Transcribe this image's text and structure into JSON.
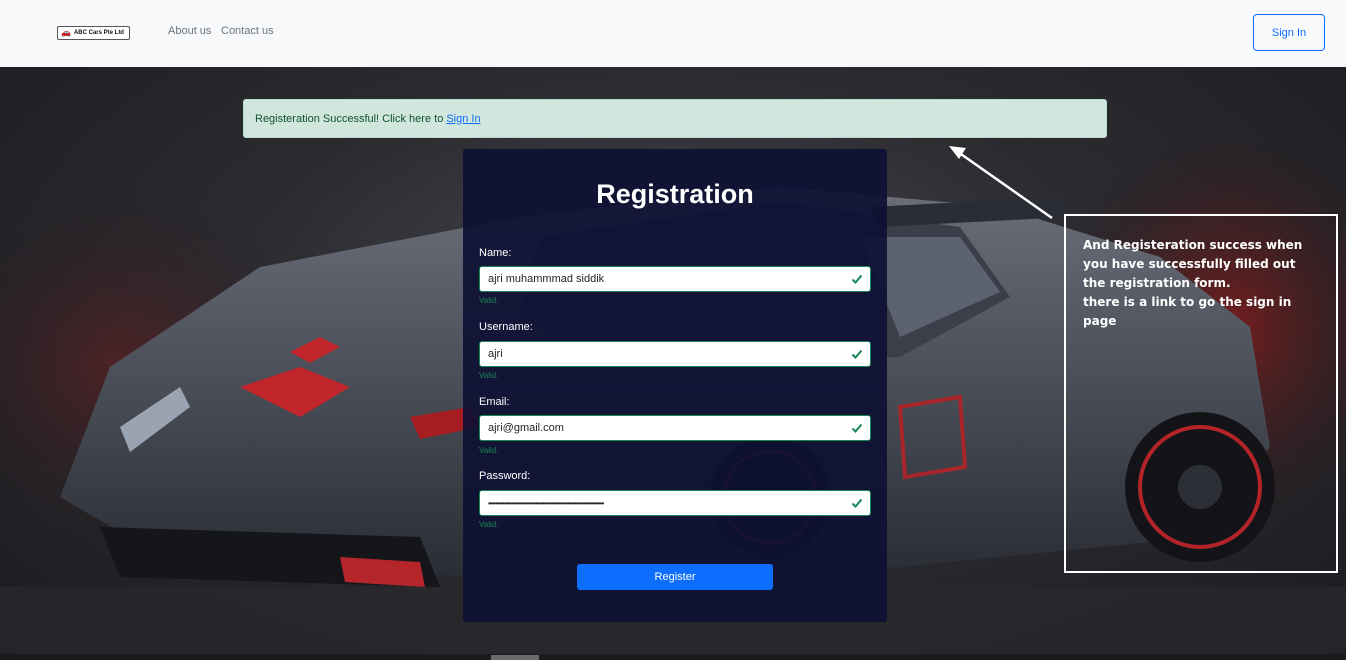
{
  "navbar": {
    "brand": "ABC Cars Pte Ltd",
    "brand_icon": "car-icon",
    "links": [
      "About us",
      "Contact us"
    ],
    "sign_in_label": "Sign In"
  },
  "alert": {
    "message": "Registeration Successful! Click here to",
    "link_label": "Sign In",
    "color": "#d1e7dd"
  },
  "form": {
    "title": "Registration",
    "fields": [
      {
        "label": "Name:",
        "value": "ajri muhammmad siddik",
        "feedback": "Valid."
      },
      {
        "label": "Username:",
        "value": "ajri",
        "feedback": "Valid."
      },
      {
        "label": "Email:",
        "value": "ajri@gmail.com",
        "feedback": "Valid."
      },
      {
        "label": "Password:",
        "value": "••••••••••••••••••••••••••••••••••••••••••••••••••••••••••••••••",
        "feedback": "Valid."
      }
    ],
    "submit_label": "Register",
    "accent": "#0d6efd",
    "valid_color": "#198754"
  },
  "annotation": {
    "text": "And Registeration success when you have successfully filled out the registration form.\nthere is a link to go the  sign in page"
  }
}
